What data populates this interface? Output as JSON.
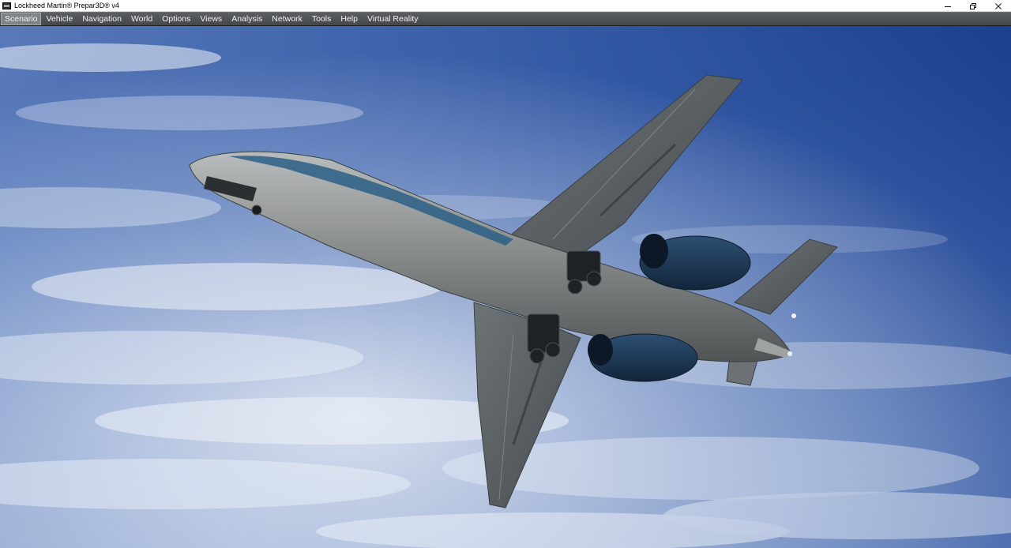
{
  "window": {
    "title": "Lockheed Martin® Prepar3D® v4",
    "icon": "prepar3d-app-icon",
    "controls": {
      "minimize_icon": "minimize-icon",
      "restore_icon": "restore-icon",
      "close_icon": "close-icon"
    }
  },
  "menubar": {
    "items": [
      {
        "label": "Scenario",
        "active": true
      },
      {
        "label": "Vehicle"
      },
      {
        "label": "Navigation"
      },
      {
        "label": "World"
      },
      {
        "label": "Options"
      },
      {
        "label": "Views"
      },
      {
        "label": "Analysis"
      },
      {
        "label": "Network"
      },
      {
        "label": "Tools"
      },
      {
        "label": "Help"
      },
      {
        "label": "Virtual Reality"
      }
    ]
  },
  "viewport": {
    "scene": "aircraft-underside-in-flight",
    "sky_colors": {
      "top": "#1f4592",
      "mid": "#5c7bb6",
      "clouds": "#e8ecf4"
    },
    "aircraft_colors": {
      "fuselage": "#7d8285",
      "wing": "#5d6366",
      "engine": "#1e3a5a",
      "stripe": "#2b5f86"
    }
  }
}
